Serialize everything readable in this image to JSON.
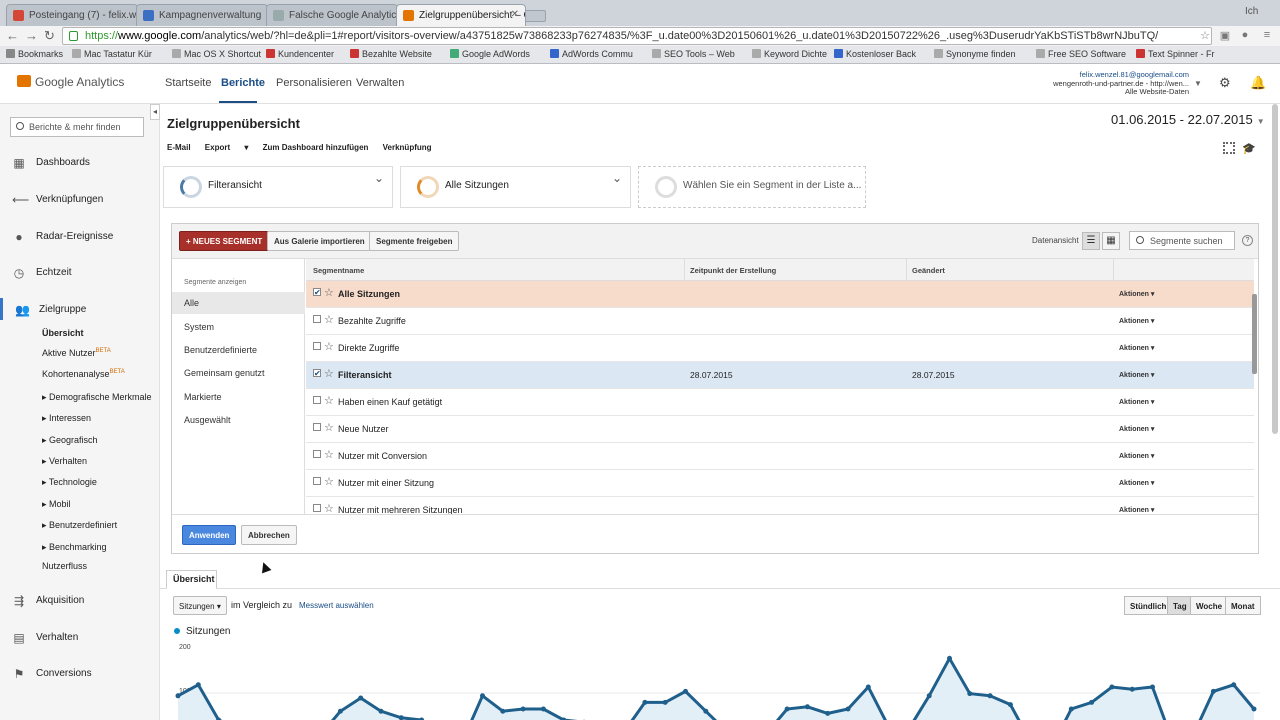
{
  "browser": {
    "tabs": [
      {
        "label": "Posteingang (7) - felix.w"
      },
      {
        "label": "Kampagnenverwaltung"
      },
      {
        "label": "Falsche Google Analytic"
      },
      {
        "label": "Zielgruppenübersicht – Go"
      }
    ],
    "profile": "Ich",
    "url": {
      "scheme": "https://",
      "host": "www.google.com",
      "path": "/analytics/web/?hl=de&pli=1#report/visitors-overview/a43751825w73868233p76274835/%3F_u.date00%3D20150601%26_u.date01%3D20150722%26_.useg%3DuserudrYaKbSTiSTb8wrNJbuTQ/"
    },
    "bookmarks": [
      "Bookmarks",
      "Mac Tastatur Kür",
      "Mac OS X Shortcut",
      "Kundencenter",
      "Bezahlte Website",
      "Google AdWords",
      "AdWords Commu",
      "SEO Tools – Web",
      "Keyword Dichte",
      "Kostenloser Back",
      "Synonyme finden",
      "Free SEO Software",
      "Text Spinner - Fr"
    ]
  },
  "ga": {
    "product": "Google Analytics",
    "nav": [
      "Startseite",
      "Berichte",
      "Personalisieren",
      "Verwalten"
    ],
    "active_nav": "Berichte",
    "account": {
      "email": "felix.wenzel.81@googlemail.com",
      "property": "wengenroth-und-partner.de - http://wen...",
      "view": "Alle Website-Daten"
    }
  },
  "sidebar": {
    "search_placeholder": "Berichte & mehr finden",
    "items": [
      {
        "label": "Dashboards",
        "icon": "grid-icon"
      },
      {
        "label": "Verknüpfungen",
        "icon": "arrow-icon"
      },
      {
        "label": "Radar-Ereignisse",
        "icon": "bulb-icon"
      },
      {
        "label": "Echtzeit",
        "icon": "clock-icon"
      },
      {
        "label": "Zielgruppe",
        "icon": "people-icon"
      }
    ],
    "sub_items": [
      {
        "label": "Übersicht",
        "beta": ""
      },
      {
        "label": "Aktive Nutzer",
        "beta": "BETA"
      },
      {
        "label": "Kohortenanalyse",
        "beta": "BETA"
      },
      {
        "label": "Demografische Merkmale",
        "beta": ""
      },
      {
        "label": "Interessen",
        "beta": ""
      },
      {
        "label": "Geografisch",
        "beta": ""
      },
      {
        "label": "Verhalten",
        "beta": ""
      },
      {
        "label": "Technologie",
        "beta": ""
      },
      {
        "label": "Mobil",
        "beta": ""
      },
      {
        "label": "Benutzerdefiniert",
        "beta": ""
      },
      {
        "label": "Benchmarking",
        "beta": ""
      },
      {
        "label": "Nutzerfluss",
        "beta": ""
      }
    ],
    "bottom_items": [
      {
        "label": "Akquisition",
        "icon": "acquisition-icon"
      },
      {
        "label": "Verhalten",
        "icon": "behavior-icon"
      },
      {
        "label": "Conversions",
        "icon": "flag-icon"
      }
    ]
  },
  "report": {
    "title": "Zielgruppenübersicht",
    "date_range": "01.06.2015 - 22.07.2015",
    "actions": [
      "E-Mail",
      "Export",
      "Zum Dashboard hinzufügen",
      "Verknüpfung"
    ]
  },
  "segments": {
    "cards": [
      "Filteransicht",
      "Alle Sitzungen",
      "Wählen Sie ein Segment in der Liste a..."
    ],
    "buttons": {
      "new": "+ NEUES SEGMENT",
      "import": "Aus Galerie importieren",
      "share": "Segmente freigeben",
      "apply": "Anwenden",
      "cancel": "Abbrechen"
    },
    "data_view_label": "Datenansicht",
    "search_placeholder": "Segmente suchen",
    "filter_heading": "Segmente anzeigen",
    "filters": [
      "Alle",
      "System",
      "Benutzerdefinierte",
      "Gemeinsam genutzt",
      "Markierte",
      "Ausgewählt"
    ],
    "columns": [
      "Segmentname",
      "Zeitpunkt der Erstellung",
      "Geändert"
    ],
    "rows": [
      {
        "name": "Alle Sitzungen",
        "created": "",
        "modified": "",
        "checked": "✔",
        "action": "Aktionen ▾"
      },
      {
        "name": "Bezahlte Zugriffe",
        "created": "",
        "modified": "",
        "checked": "",
        "action": "Aktionen ▾"
      },
      {
        "name": "Direkte Zugriffe",
        "created": "",
        "modified": "",
        "checked": "",
        "action": "Aktionen ▾"
      },
      {
        "name": "Filteransicht",
        "created": "28.07.2015",
        "modified": "28.07.2015",
        "checked": "✔",
        "action": "Aktionen ▾"
      },
      {
        "name": "Haben einen Kauf getätigt",
        "created": "",
        "modified": "",
        "checked": "",
        "action": "Aktionen ▾"
      },
      {
        "name": "Neue Nutzer",
        "created": "",
        "modified": "",
        "checked": "",
        "action": "Aktionen ▾"
      },
      {
        "name": "Nutzer mit Conversion",
        "created": "",
        "modified": "",
        "checked": "",
        "action": "Aktionen ▾"
      },
      {
        "name": "Nutzer mit einer Sitzung",
        "created": "",
        "modified": "",
        "checked": "",
        "action": "Aktionen ▾"
      },
      {
        "name": "Nutzer mit mehreren Sitzungen",
        "created": "",
        "modified": "",
        "checked": "",
        "action": "Aktionen ▾"
      }
    ]
  },
  "overview": {
    "tab": "Übersicht",
    "metric": "Sitzungen",
    "compare_label": "im Vergleich zu",
    "compare_link": "Messwert auswählen",
    "granularity": [
      "Stündlich",
      "Tag",
      "Woche",
      "Monat"
    ],
    "active_granularity": "Tag",
    "legend": "Sitzungen"
  },
  "chart_data": {
    "type": "line",
    "series": [
      {
        "name": "Sitzungen",
        "values": [
          130,
          155,
          75,
          55,
          20,
          10,
          20,
          40,
          95,
          125,
          95,
          80,
          75,
          5,
          25,
          130,
          95,
          100,
          100,
          75,
          70,
          30,
          50,
          115,
          115,
          140,
          95,
          50,
          15,
          45,
          100,
          105,
          90,
          100,
          150,
          60,
          55,
          130,
          215,
          135,
          130,
          110,
          25,
          10,
          100,
          115,
          150,
          145,
          150,
          25,
          40,
          140,
          155,
          100
        ]
      }
    ],
    "yticks": [
      "200",
      "100"
    ],
    "ylim": [
      0,
      220
    ],
    "colors": {
      "line": "#1f5f8b",
      "fill": "#e3eff7"
    }
  }
}
